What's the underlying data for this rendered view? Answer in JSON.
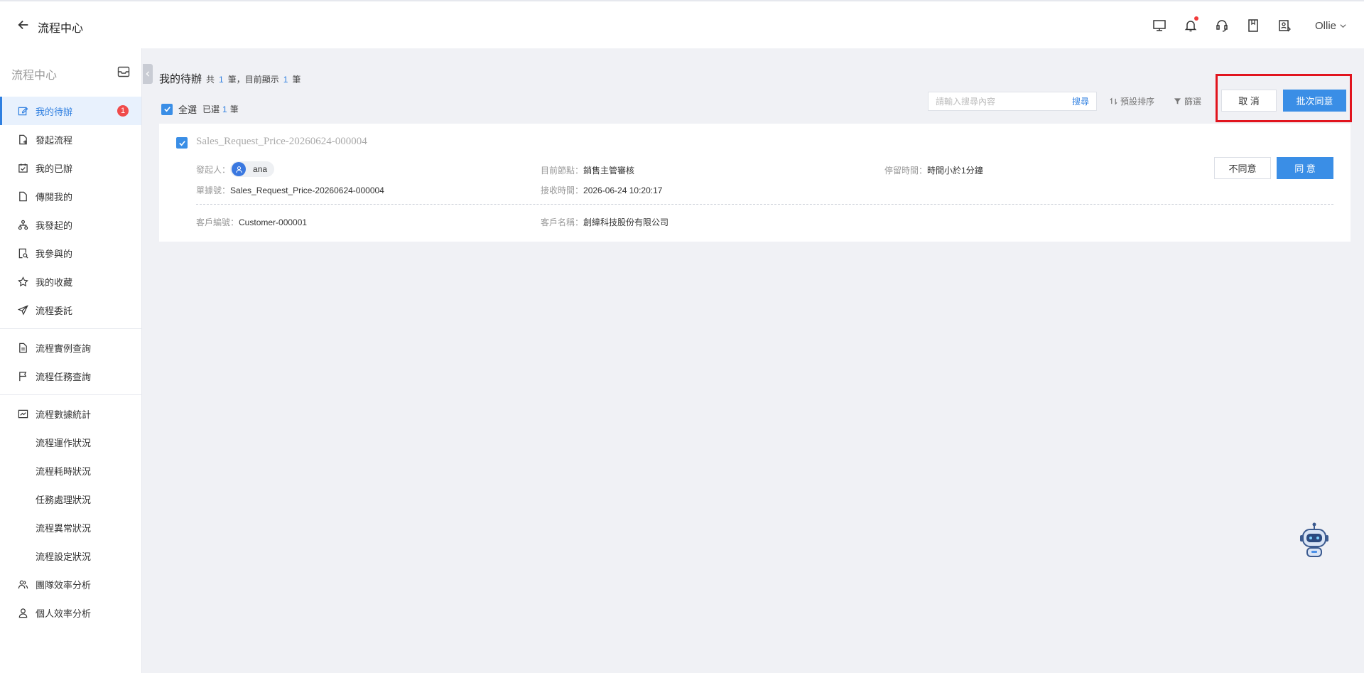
{
  "header": {
    "title": "流程中心",
    "user": "Ollie",
    "icons": [
      "monitor-icon",
      "bell-icon",
      "headset-icon",
      "book-icon",
      "user-card-icon"
    ]
  },
  "sidebar": {
    "title": "流程中心",
    "items": [
      {
        "label": "我的待辦",
        "icon": "edit-icon",
        "badge": "1",
        "active": true
      },
      {
        "label": "發起流程",
        "icon": "file-plus-icon"
      },
      {
        "label": "我的已辦",
        "icon": "calendar-check-icon"
      },
      {
        "label": "傳閱我的",
        "icon": "document-icon"
      },
      {
        "label": "我發起的",
        "icon": "org-chart-icon"
      },
      {
        "label": "我參與的",
        "icon": "file-search-icon"
      },
      {
        "label": "我的收藏",
        "icon": "star-icon"
      },
      {
        "label": "流程委託",
        "icon": "send-icon"
      },
      {
        "label": "流程實例查詢",
        "icon": "file-search-icon"
      },
      {
        "label": "流程任務查詢",
        "icon": "flag-icon"
      },
      {
        "label": "流程數據統計",
        "icon": "line-chart-icon"
      },
      {
        "label": "流程運作狀況"
      },
      {
        "label": "流程耗時狀況"
      },
      {
        "label": "任務處理狀況"
      },
      {
        "label": "流程異常狀況"
      },
      {
        "label": "流程設定狀況"
      },
      {
        "label": "團隊效率分析",
        "icon": "team-icon"
      },
      {
        "label": "個人效率分析",
        "icon": "person-icon"
      }
    ]
  },
  "main": {
    "title": "我的待辦",
    "count_prefix": "共",
    "count_total": "1",
    "count_mid": "筆，目前顯示",
    "count_shown": "1",
    "count_suffix": "筆",
    "select_all": "全選",
    "selected_prefix": "已選",
    "selected_count": "1",
    "selected_suffix": "筆",
    "search_placeholder": "請輸入搜尋內容",
    "search_button": "搜尋",
    "sort_label": "預設排序",
    "filter_label": "篩選",
    "cancel_button": "取 消",
    "batch_button": "批次同意"
  },
  "card": {
    "title": "Sales_Request_Price-20260624-000004",
    "initiator_label": "發起人：",
    "initiator": "ana",
    "node_label": "目前節點：",
    "node": "銷售主管審核",
    "stay_label": "停留時間：",
    "stay": "時間小於1分鐘",
    "doc_label": "單據號：",
    "doc": "Sales_Request_Price-20260624-000004",
    "recv_label": "接收時間：",
    "recv": "2026-06-24 10:20:17",
    "cust_no_label": "客戶編號：",
    "cust_no": "Customer-000001",
    "cust_name_label": "客戶名稱：",
    "cust_name": "創緯科技股份有限公司",
    "disagree_button": "不同意",
    "agree_button": "同 意"
  },
  "colors": {
    "accent": "#3a8ee6",
    "badge": "#f04b4b",
    "highlight": "#e1141e"
  }
}
